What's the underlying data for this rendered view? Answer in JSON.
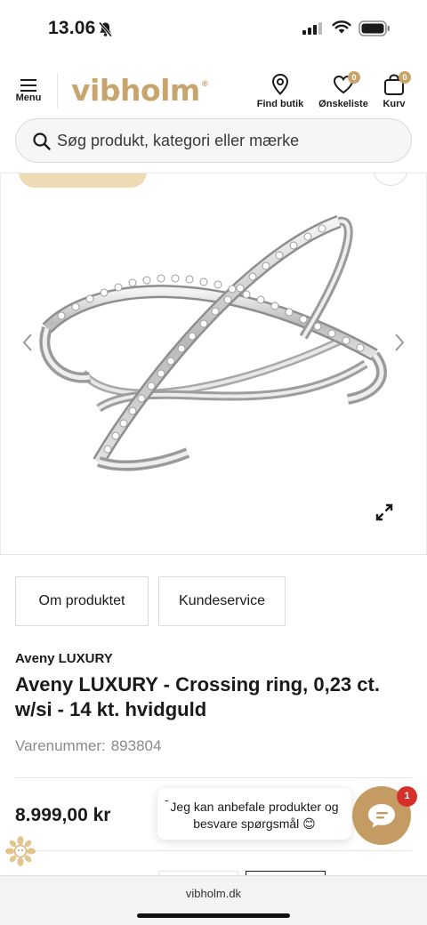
{
  "status_bar": {
    "time": "13.06"
  },
  "header": {
    "menu_label": "Menu",
    "logo_text": "vibholm",
    "logo_mark": "®",
    "find_store_label": "Find butik",
    "wishlist_label": "Ønskeliste",
    "wishlist_count": "0",
    "cart_label": "Kurv",
    "cart_count": "0"
  },
  "search": {
    "placeholder": "Søg produkt, kategori eller mærke"
  },
  "product": {
    "tabs": [
      "Om produktet",
      "Kundeservice"
    ],
    "brand": "Aveny LUXURY",
    "title": "Aveny LUXURY - Crossing ring, 0,23 ct. w/si - 14 kt. hvidguld",
    "sku_label": "Varenummer:",
    "sku": "893804",
    "price": "8.999,00 kr"
  },
  "chat": {
    "close_label": "-",
    "message": "Jeg kan anbefale produkter og besvare spørgsmål 😊",
    "notification_count": "1"
  },
  "browser": {
    "url": "vibholm.dk"
  },
  "colors": {
    "brand_gold": "#c7a56d",
    "chat_gold": "#c49b62",
    "notification_red": "#d6302a",
    "pill": "#eedbb3"
  },
  "icons": [
    "bell-slash-icon",
    "signal-icon",
    "wifi-icon",
    "battery-icon",
    "hamburger-icon",
    "location-pin-icon",
    "heart-icon",
    "bag-icon",
    "search-icon",
    "chevron-left-icon",
    "chevron-right-icon",
    "expand-icon",
    "chat-icon",
    "leaf-badge-icon"
  ]
}
